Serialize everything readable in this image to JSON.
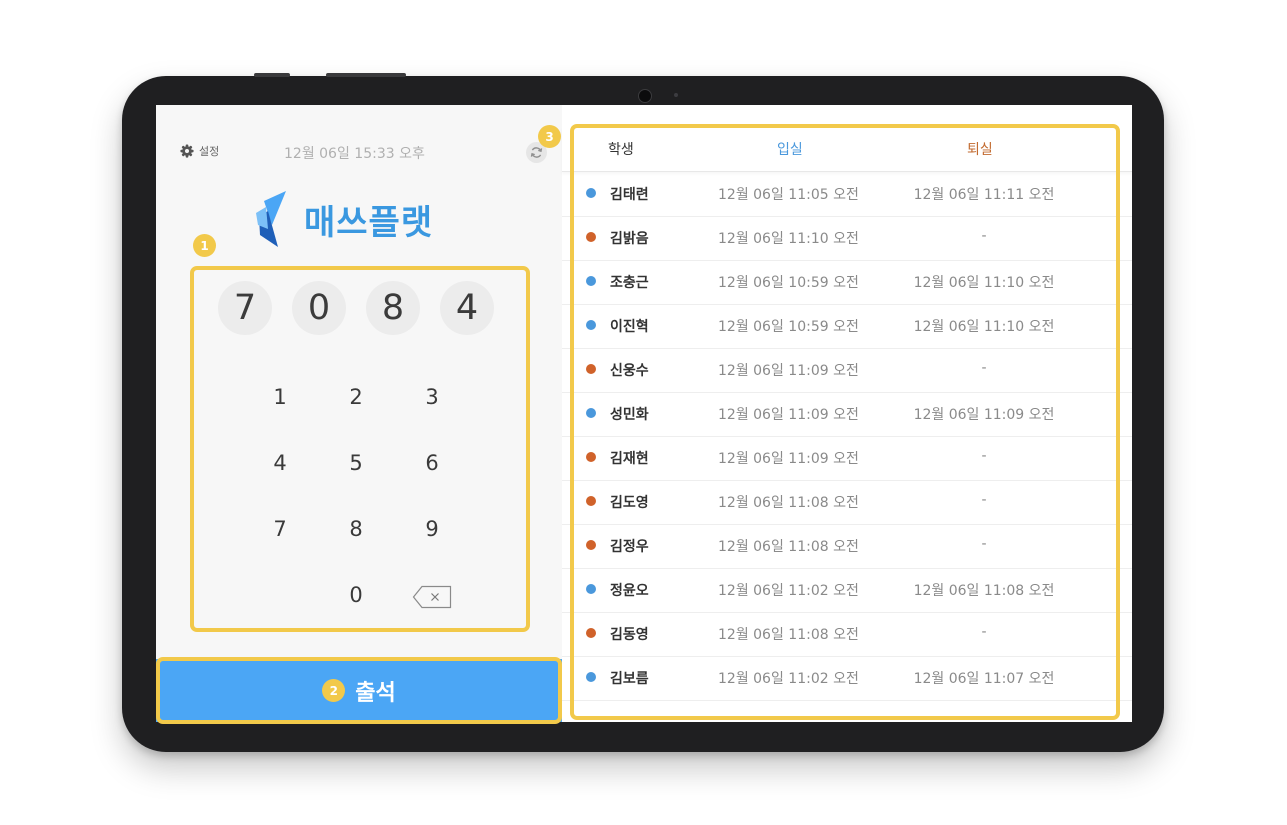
{
  "app": {
    "settings_label": "설정",
    "datetime": "12월 06일 15:33 오후",
    "logo_text": "매쓰플랫",
    "icons": {
      "settings": "gear-icon",
      "refresh": "refresh-icon",
      "backspace": "backspace-icon"
    }
  },
  "pin": {
    "digits": [
      "7",
      "0",
      "8",
      "4"
    ]
  },
  "keypad": {
    "k1": "1",
    "k2": "2",
    "k3": "3",
    "k4": "4",
    "k5": "5",
    "k6": "6",
    "k7": "7",
    "k8": "8",
    "k9": "9",
    "k0": "0"
  },
  "attend_button": {
    "label": "출석"
  },
  "table": {
    "headers": {
      "student": "학생",
      "check_in": "입실",
      "check_out": "퇴실"
    },
    "rows": [
      {
        "name": "김태련",
        "in": "12월 06일 11:05 오전",
        "out": "12월 06일 11:11 오전",
        "status": "out"
      },
      {
        "name": "김밝음",
        "in": "12월 06일 11:10 오전",
        "out": "-",
        "status": "in"
      },
      {
        "name": "조충근",
        "in": "12월 06일 10:59 오전",
        "out": "12월 06일 11:10 오전",
        "status": "out"
      },
      {
        "name": "이진혁",
        "in": "12월 06일 10:59 오전",
        "out": "12월 06일 11:10 오전",
        "status": "out"
      },
      {
        "name": "신웅수",
        "in": "12월 06일 11:09 오전",
        "out": "-",
        "status": "in"
      },
      {
        "name": "성민화",
        "in": "12월 06일 11:09 오전",
        "out": "12월 06일 11:09 오전",
        "status": "out"
      },
      {
        "name": "김재현",
        "in": "12월 06일 11:09 오전",
        "out": "-",
        "status": "in"
      },
      {
        "name": "김도영",
        "in": "12월 06일 11:08 오전",
        "out": "-",
        "status": "in"
      },
      {
        "name": "김정우",
        "in": "12월 06일 11:08 오전",
        "out": "-",
        "status": "in"
      },
      {
        "name": "정윤오",
        "in": "12월 06일 11:02 오전",
        "out": "12월 06일 11:08 오전",
        "status": "out"
      },
      {
        "name": "김동영",
        "in": "12월 06일 11:08 오전",
        "out": "-",
        "status": "in"
      },
      {
        "name": "김보름",
        "in": "12월 06일 11:02 오전",
        "out": "12월 06일 11:07 오전",
        "status": "out"
      }
    ]
  },
  "annotations": {
    "b1": "1",
    "b2": "2",
    "b3": "3"
  },
  "colors": {
    "accent": "#4ba6f5",
    "status_out": "#4a98dc",
    "status_in": "#d0622a",
    "highlight": "#f2c94a"
  }
}
